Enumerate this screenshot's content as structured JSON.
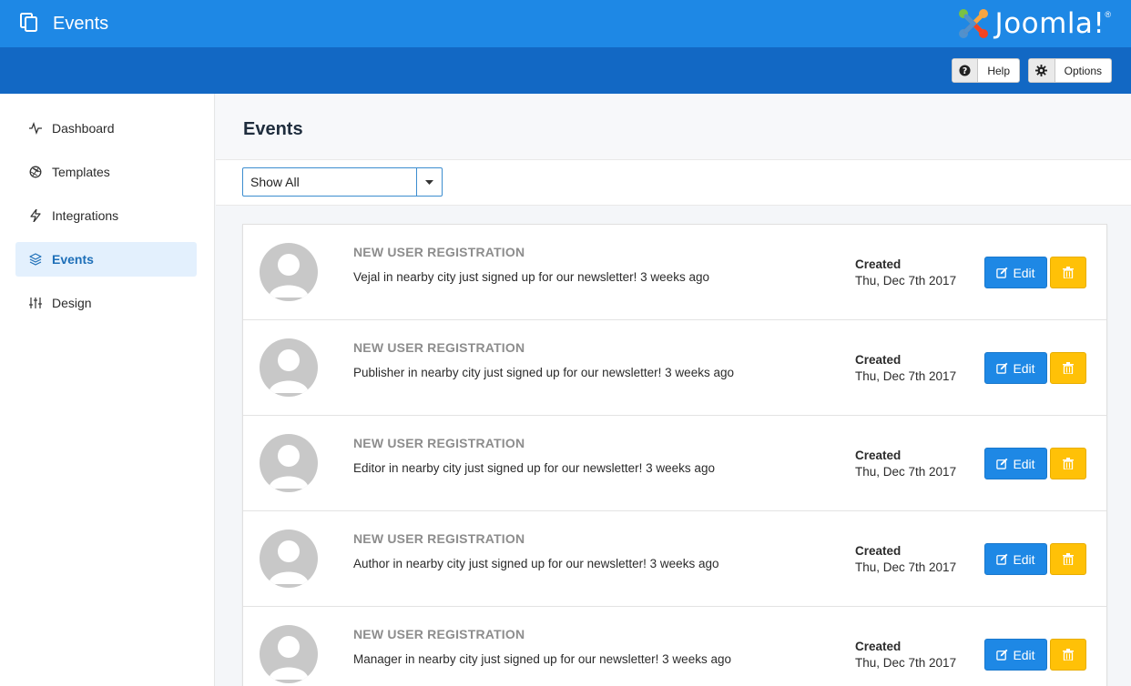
{
  "header": {
    "title": "Events",
    "page_icon": "copy-icon",
    "brand": {
      "name": "Joomla!",
      "logo_icon": "joomla-logo-icon",
      "colors": [
        "#7ac143",
        "#f9a541",
        "#f44321",
        "#5091cd"
      ]
    }
  },
  "toolbar": {
    "help_label": "Help",
    "help_icon": "question-circle-icon",
    "options_label": "Options",
    "options_icon": "gear-icon"
  },
  "sidebar": {
    "items": [
      {
        "label": "Dashboard",
        "icon": "activity-icon",
        "active": false
      },
      {
        "label": "Templates",
        "icon": "aperture-icon",
        "active": false
      },
      {
        "label": "Integrations",
        "icon": "lightning-icon",
        "active": false
      },
      {
        "label": "Events",
        "icon": "layers-icon",
        "active": true
      },
      {
        "label": "Design",
        "icon": "sliders-icon",
        "active": false
      }
    ]
  },
  "main": {
    "title": "Events",
    "filter": {
      "selected": "Show All"
    },
    "events": [
      {
        "title": "NEW USER REGISTRATION",
        "message": "Vejal in nearby city just signed up for our newsletter! 3 weeks ago",
        "created_label": "Created",
        "created_date": "Thu, Dec 7th 2017",
        "edit_label": "Edit"
      },
      {
        "title": "NEW USER REGISTRATION",
        "message": "Publisher in nearby city just signed up for our newsletter! 3 weeks ago",
        "created_label": "Created",
        "created_date": "Thu, Dec 7th 2017",
        "edit_label": "Edit"
      },
      {
        "title": "NEW USER REGISTRATION",
        "message": "Editor in nearby city just signed up for our newsletter! 3 weeks ago",
        "created_label": "Created",
        "created_date": "Thu, Dec 7th 2017",
        "edit_label": "Edit"
      },
      {
        "title": "NEW USER REGISTRATION",
        "message": "Author in nearby city just signed up for our newsletter! 3 weeks ago",
        "created_label": "Created",
        "created_date": "Thu, Dec 7th 2017",
        "edit_label": "Edit"
      },
      {
        "title": "NEW USER REGISTRATION",
        "message": "Manager in nearby city just signed up for our newsletter! 3 weeks ago",
        "created_label": "Created",
        "created_date": "Thu, Dec 7th 2017",
        "edit_label": "Edit"
      }
    ]
  },
  "colors": {
    "header": "#1e88e5",
    "toolbar": "#1268c4",
    "edit_button": "#1e88e5",
    "delete_button": "#ffc107",
    "active_nav_bg": "#e3f0fd"
  }
}
